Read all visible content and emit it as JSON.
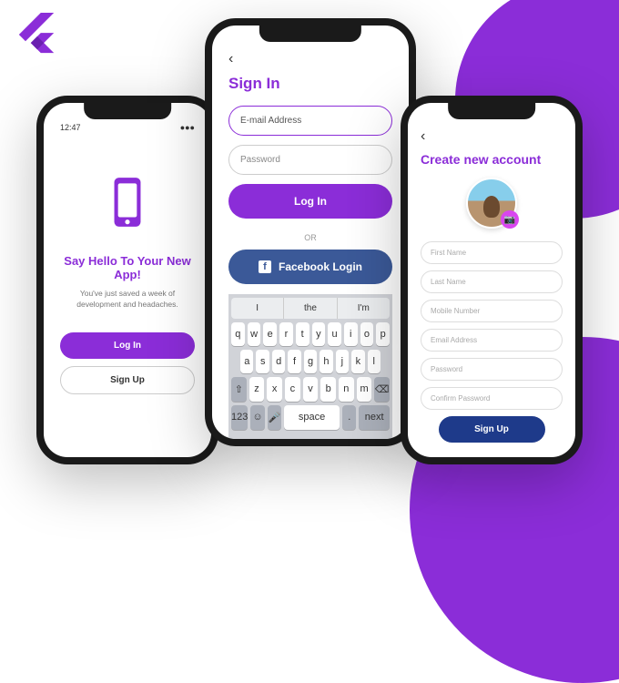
{
  "colors": {
    "purple": "#8b2dd8",
    "fb": "#3b5998",
    "navy": "#1e3a8a"
  },
  "phone1": {
    "time": "12:47",
    "title": "Say Hello To Your New App!",
    "subtitle": "You've just saved a week of development and headaches.",
    "login": "Log In",
    "signup": "Sign Up"
  },
  "phone2": {
    "title": "Sign In",
    "email_ph": "E-mail Address",
    "password_ph": "Password",
    "login": "Log In",
    "or": "OR",
    "fb": "Facebook Login",
    "suggestions": [
      "I",
      "the",
      "I'm"
    ],
    "row1": [
      "q",
      "w",
      "e",
      "r",
      "t",
      "y",
      "u",
      "i",
      "o",
      "p"
    ],
    "row2": [
      "a",
      "s",
      "d",
      "f",
      "g",
      "h",
      "j",
      "k",
      "l"
    ],
    "row3": [
      "z",
      "x",
      "c",
      "v",
      "b",
      "n",
      "m"
    ],
    "shift": "⇧",
    "bksp": "⌫",
    "num": "123",
    "emoji": "☺",
    "mic": "🎤",
    "space": "space",
    "dot": ".",
    "next": "next"
  },
  "phone3": {
    "title": "Create new account",
    "fields": [
      "First Name",
      "Last Name",
      "Mobile Number",
      "Email Address",
      "Password",
      "Confirm Password"
    ],
    "signup": "Sign Up"
  }
}
